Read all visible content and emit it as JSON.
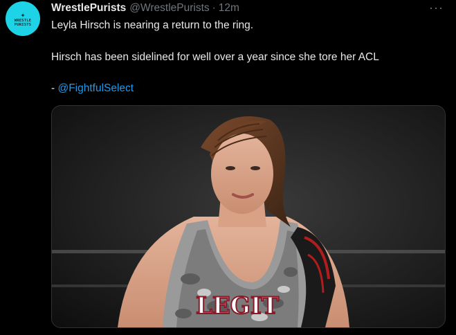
{
  "tweet": {
    "author_name": "WrestlePurists",
    "author_handle": "@WrestlePurists",
    "separator": "·",
    "time": "12m",
    "more_label": "···",
    "avatar": {
      "logo_text_top": "WRESTLE",
      "logo_text_bottom": "PURISTS",
      "logo_icon": "wrestler-silhouette-icon",
      "color": "#1fd3e6"
    },
    "text_line_1": "Leyla Hirsch is nearing a return to the ring.",
    "text_line_2": "Hirsch has been sidelined for well over a year since she tore her ACL",
    "text_line_3_prefix": "- ",
    "mention": "@FightfulSelect",
    "media": {
      "description_icon": "photo-icon",
      "shirt_text": "LEGIT"
    }
  },
  "colors": {
    "background": "#000000",
    "text": "#e7e9ea",
    "muted": "#71767b",
    "link": "#1d9bf0",
    "border": "#2f3336"
  }
}
